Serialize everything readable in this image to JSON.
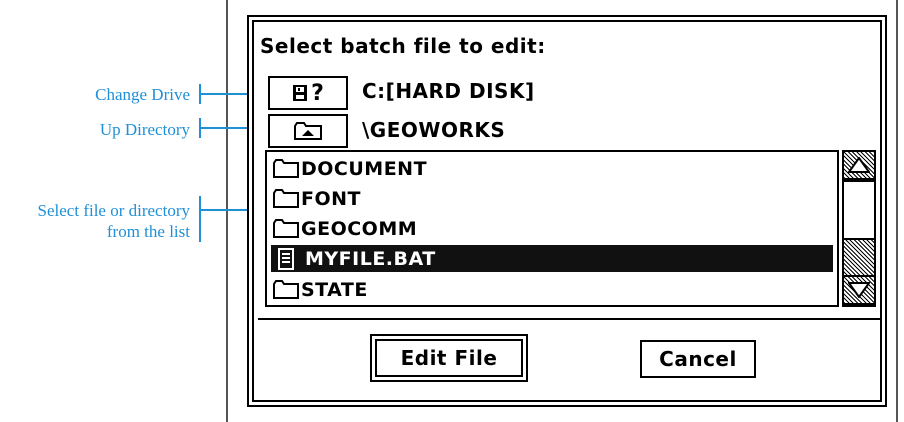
{
  "callouts": {
    "color": "#1f8fd6",
    "change_drive": "Change Drive",
    "up_directory": "Up Directory",
    "select_file_line1": "Select file or directory",
    "select_file_line2": "from the list"
  },
  "dialog": {
    "title": "Select batch file to edit:",
    "drive_button_glyph": "?",
    "drive_path": "C:[HARD DISK]",
    "current_directory": "\\GEOWORKS",
    "files": [
      {
        "name": "DOCUMENT",
        "icon": "folder-icon",
        "selected": false
      },
      {
        "name": "FONT",
        "icon": "folder-icon",
        "selected": false
      },
      {
        "name": "GEOCOMM",
        "icon": "folder-icon",
        "selected": false
      },
      {
        "name": "MYFILE.BAT",
        "icon": "document-icon",
        "selected": true
      },
      {
        "name": "STATE",
        "icon": "folder-icon",
        "selected": false
      }
    ],
    "edit_button": "Edit File",
    "cancel_button": "Cancel"
  }
}
